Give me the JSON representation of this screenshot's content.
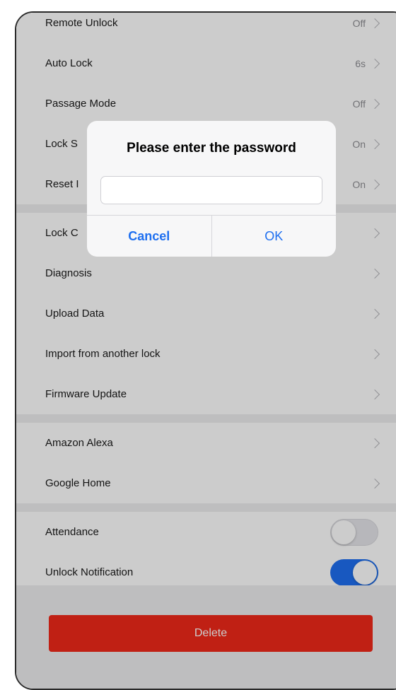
{
  "settings": {
    "group1": [
      {
        "label": "Remote Unlock",
        "value": "Off"
      },
      {
        "label": "Auto Lock",
        "value": "6s"
      },
      {
        "label": "Passage Mode",
        "value": "Off"
      },
      {
        "label": "Lock S",
        "value": "On"
      },
      {
        "label": "Reset I",
        "value": "On"
      }
    ],
    "group2": [
      {
        "label": "Lock C"
      },
      {
        "label": "Diagnosis"
      },
      {
        "label": "Upload Data"
      },
      {
        "label": "Import from another lock"
      },
      {
        "label": "Firmware Update"
      }
    ],
    "group3": [
      {
        "label": "Amazon Alexa"
      },
      {
        "label": "Google Home"
      }
    ],
    "toggles": [
      {
        "label": "Attendance",
        "state": "off"
      },
      {
        "label": "Unlock Notification",
        "state": "on"
      }
    ]
  },
  "delete_label": "Delete",
  "dialog": {
    "title": "Please enter the password",
    "input_value": "",
    "cancel_label": "Cancel",
    "ok_label": "OK"
  },
  "colors": {
    "accent": "#1e6ff0",
    "danger": "#f0291a"
  },
  "icons": {
    "row_chevron": "chevron-right-icon"
  }
}
